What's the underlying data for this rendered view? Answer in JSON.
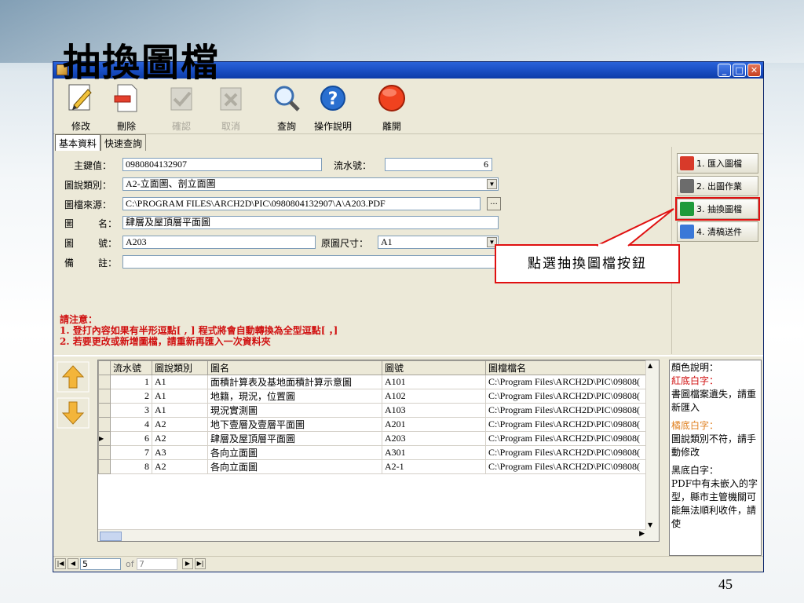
{
  "slide": {
    "title": "抽換圖檔",
    "page_number": "45"
  },
  "window": {
    "title": "抽換圖檔"
  },
  "toolbar": [
    {
      "label": "修改",
      "icon": "pencil-icon",
      "enabled": true
    },
    {
      "label": "刪除",
      "icon": "delete-document-icon",
      "enabled": true
    },
    {
      "label": "確認",
      "icon": "confirm-icon",
      "enabled": false
    },
    {
      "label": "取消",
      "icon": "cancel-icon",
      "enabled": false
    },
    {
      "label": "查詢",
      "icon": "magnifier-icon",
      "enabled": true
    },
    {
      "label": "操作說明",
      "icon": "help-icon",
      "enabled": true
    },
    {
      "label": "離開",
      "icon": "exit-icon",
      "enabled": true
    }
  ],
  "tabs": [
    "基本資料",
    "快速查詢"
  ],
  "form": {
    "key_label": "主鍵值：",
    "key_value": "0980804132907",
    "serial_label": "流水號：",
    "serial_value": "6",
    "category_label": "圖說類別：",
    "category_value": "A2-立面圖、剖立面圖",
    "source_label": "圖檔來源：",
    "source_value": "C:\\PROGRAM FILES\\ARCH2D\\PIC\\0980804132907\\A\\A203.PDF",
    "browse_label": "...",
    "name_label_1": "圖",
    "name_label_2": "名：",
    "name_value": "肆層及屋頂層平面圖",
    "number_label_1": "圖",
    "number_label_2": "號：",
    "number_value": "A203",
    "size_label": "原圖尺寸：",
    "size_value": "A1",
    "remark_label_1": "備",
    "remark_label_2": "註：",
    "remark_value": ""
  },
  "notice": {
    "heading": "請注意：",
    "line1": "1. 登打內容如果有半形逗點[ , ]   程式將會自動轉換為全型逗點[ ，]",
    "line2": "2. 若要更改或新增圖檔，請重新再匯入一次資料夾"
  },
  "right_panel": [
    {
      "label": "1. 匯入圖檔",
      "icon": "import-icon",
      "color": "#d83a2a"
    },
    {
      "label": "2. 出圖作業",
      "icon": "printer-icon",
      "color": "#6c6c6c"
    },
    {
      "label": "3. 抽換圖檔",
      "icon": "swap-icon",
      "color": "#1f9a3a",
      "highlighted": true
    },
    {
      "label": "4. 清稿送件",
      "icon": "send-icon",
      "color": "#3a78d8"
    }
  ],
  "callout": {
    "text": "點選抽換圖檔按鈕"
  },
  "table": {
    "columns": [
      "流水號",
      "圖說類別",
      "圖名",
      "圖號",
      "圖檔檔名"
    ],
    "rows": [
      [
        "1",
        "A1",
        "面積計算表及基地面積計算示意圖",
        "A101",
        "C:\\Program Files\\ARCH2D\\PIC\\09808("
      ],
      [
        "2",
        "A1",
        "地籍，現況，位置圖",
        "A102",
        "C:\\Program Files\\ARCH2D\\PIC\\09808("
      ],
      [
        "3",
        "A1",
        "現況實測圖",
        "A103",
        "C:\\Program Files\\ARCH2D\\PIC\\09808("
      ],
      [
        "4",
        "A2",
        "地下壹層及壹層平面圖",
        "A201",
        "C:\\Program Files\\ARCH2D\\PIC\\09808("
      ],
      [
        "6",
        "A2",
        "肆層及屋頂層平面圖",
        "A203",
        "C:\\Program Files\\ARCH2D\\PIC\\09808("
      ],
      [
        "7",
        "A3",
        "各向立面圖",
        "A301",
        "C:\\Program Files\\ARCH2D\\PIC\\09808("
      ],
      [
        "8",
        "A2",
        "各向立面圖",
        "A2-1",
        "C:\\Program Files\\ARCH2D\\PIC\\09808("
      ]
    ],
    "selected_row": 4
  },
  "legend": {
    "title": "顏色說明：",
    "red_title": "紅底白字：",
    "red_desc": "書圖檔案遺失，請重新匯入",
    "orange_title": "橘底白字：",
    "orange_desc": "圖說類別不符，請手動修改",
    "black_title": "黑底白字：",
    "black_desc": "PDF中有未嵌入的字型，縣市主管機關可能無法順利收件，請使"
  },
  "status": {
    "record": "5",
    "of_label": "of",
    "total": "7"
  },
  "colors": {
    "titlebar": "#0c3ba8",
    "accent_red": "#e01010",
    "window_bg": "#ece9d8"
  }
}
